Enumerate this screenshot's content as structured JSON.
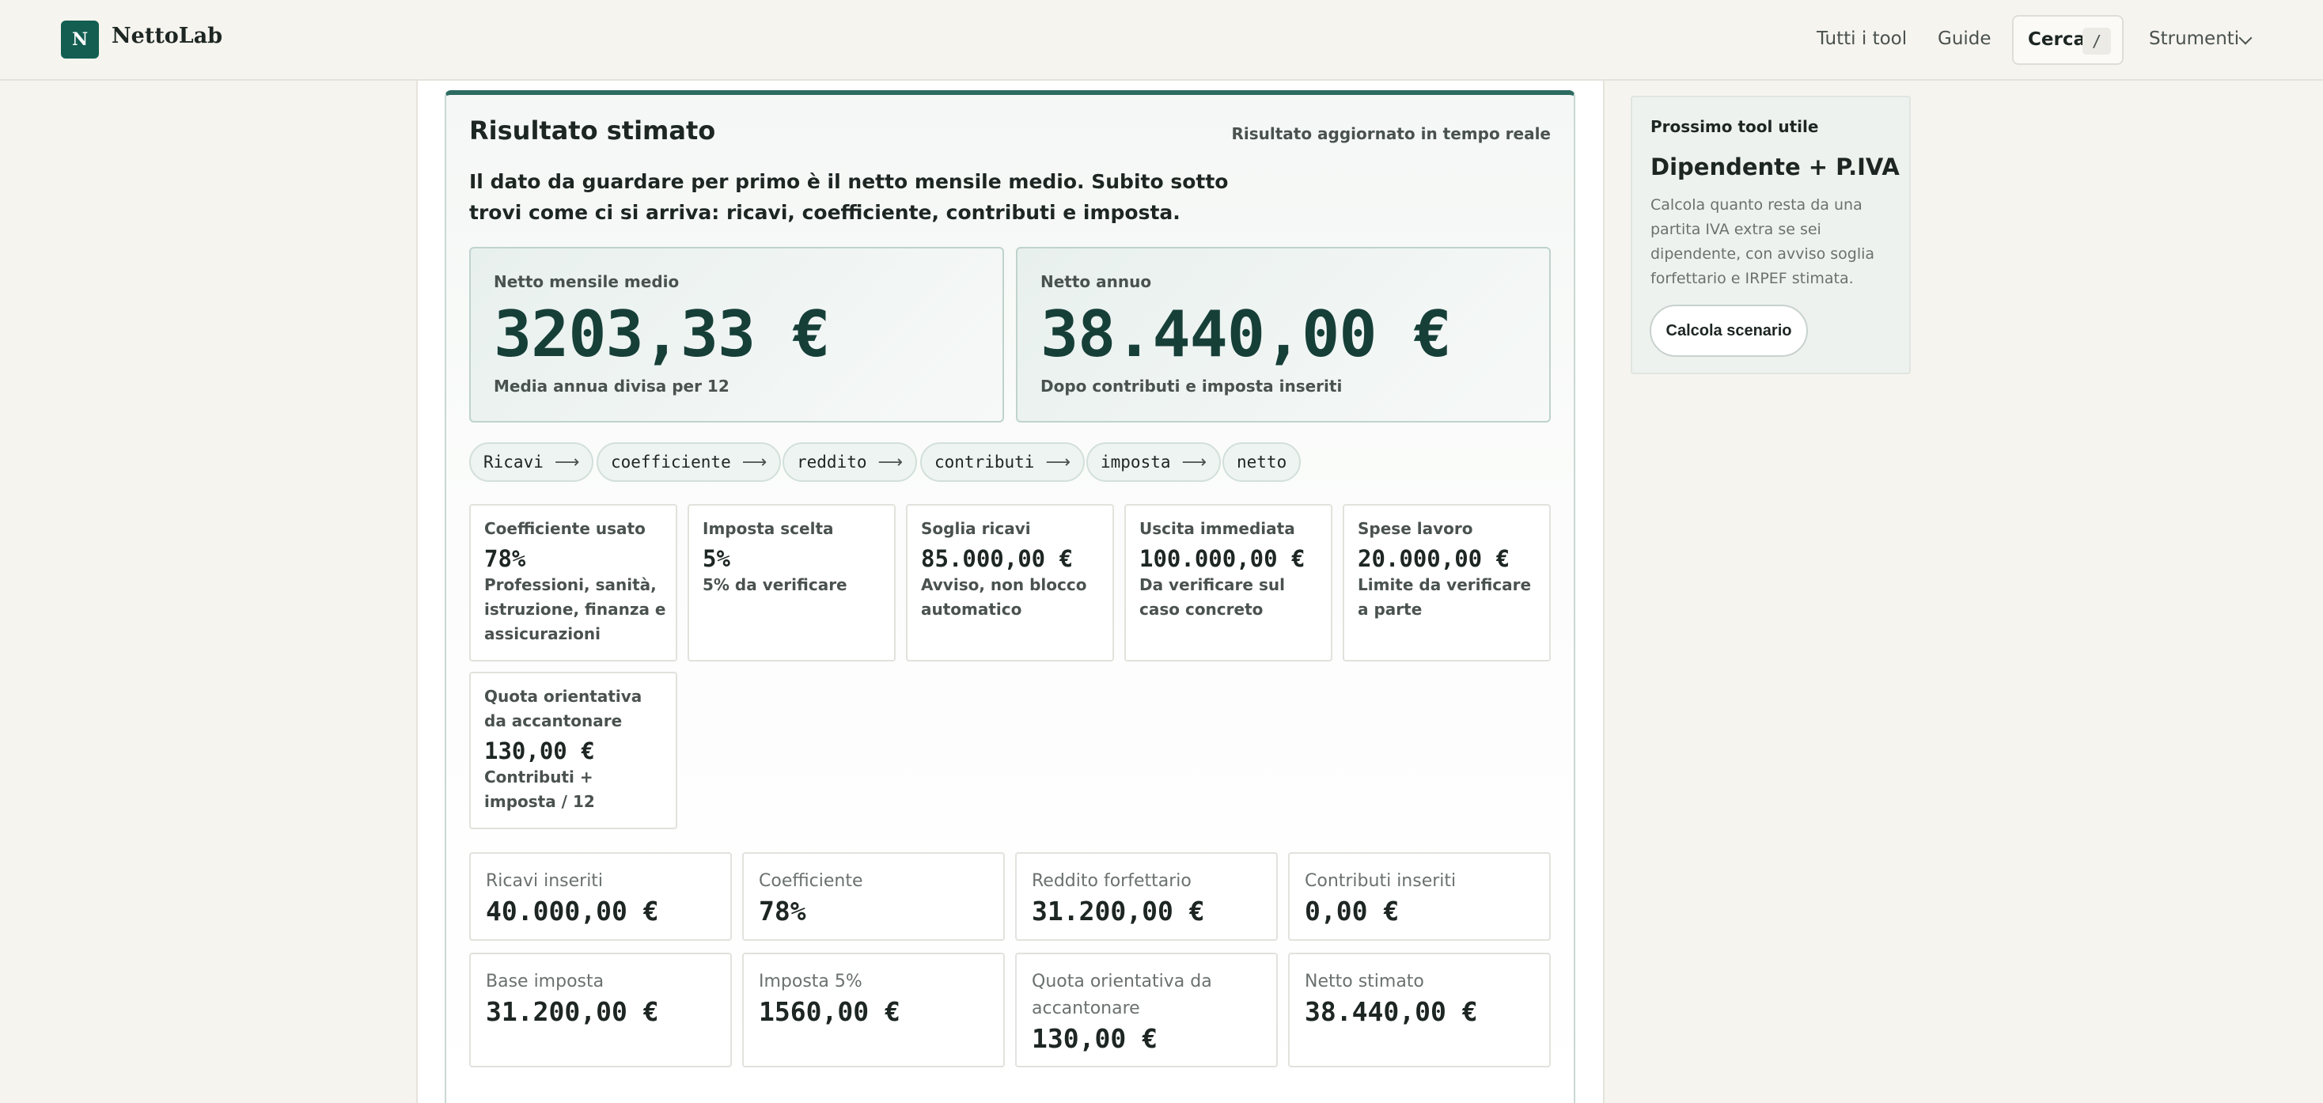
{
  "header": {
    "logo_letter": "N",
    "brand": "NettoLab",
    "nav": {
      "all_tools": "Tutti i tool",
      "guides": "Guide",
      "search": "Cerca",
      "search_shortcut": "/",
      "tools": "Strumenti"
    }
  },
  "result": {
    "title": "Risultato stimato",
    "live_note": "Risultato aggiornato in tempo reale",
    "intro": "Il dato da guardare per primo è il netto mensile medio. Subito sotto trovi come ci si arriva: ricavi, coefficiente, contributi e imposta.",
    "monthly": {
      "label": "Netto mensile medio",
      "value": "3203,33 €",
      "note": "Media annua divisa per 12"
    },
    "annual": {
      "label": "Netto annuo",
      "value": "38.440,00 €",
      "note": "Dopo contributi e imposta inseriti"
    },
    "flow": [
      "Ricavi",
      "coefficiente",
      "reddito",
      "contributi",
      "imposta",
      "netto"
    ],
    "flow_arrow": "⟶",
    "stats": [
      {
        "label": "Coefficiente usato",
        "value": "78%",
        "note": "Professioni, sanità, istruzione, finanza e assicurazioni"
      },
      {
        "label": "Imposta scelta",
        "value": "5%",
        "note": "5% da verificare"
      },
      {
        "label": "Soglia ricavi",
        "value": "85.000,00 €",
        "note": "Avviso, non blocco automatico"
      },
      {
        "label": "Uscita immediata",
        "value": "100.000,00 €",
        "note": "Da verificare sul caso concreto"
      },
      {
        "label": "Spese lavoro",
        "value": "20.000,00 €",
        "note": "Limite da verificare a parte"
      },
      {
        "label": "Quota orientativa da accantonare",
        "value": "130,00 €",
        "note": "Contributi + imposta / 12"
      }
    ],
    "summary": [
      {
        "label": "Ricavi inseriti",
        "value": "40.000,00 €"
      },
      {
        "label": "Coefficiente",
        "value": "78%"
      },
      {
        "label": "Reddito forfettario",
        "value": "31.200,00 €"
      },
      {
        "label": "Contributi inseriti",
        "value": "0,00 €"
      },
      {
        "label": "Base imposta",
        "value": "31.200,00 €"
      },
      {
        "label": "Imposta 5%",
        "value": "1560,00 €"
      },
      {
        "label": "Quota orientativa da accantonare",
        "value": "130,00 €"
      },
      {
        "label": "Netto stimato",
        "value": "38.440,00 €"
      }
    ]
  },
  "aside": {
    "kicker": "Prossimo tool utile",
    "title": "Dipendente + P.IVA",
    "description": "Calcola quanto resta da una partita IVA extra se sei dipendente, con avviso soglia forfettario e IRPEF stimata.",
    "cta": "Calcola scenario"
  }
}
